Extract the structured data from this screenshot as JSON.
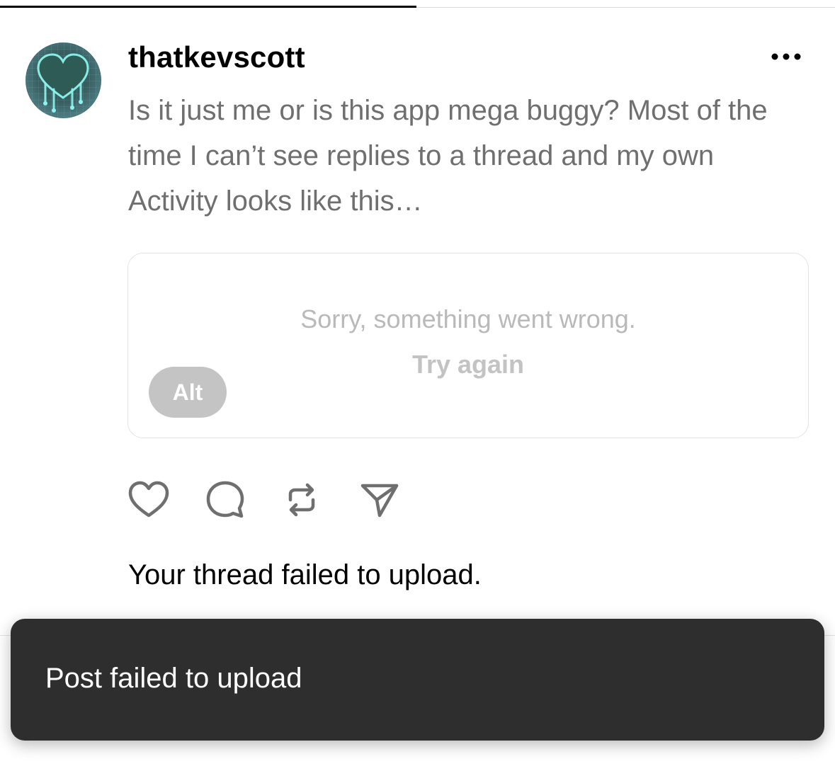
{
  "tabs": {
    "active_index": 0
  },
  "post": {
    "username": "thatkevscott",
    "text": "Is it just me or is this app mega buggy? Most of the time I can’t see replies to a thread and my own Activity looks like this…",
    "avatar_icon": "neon-heart-avatar-icon",
    "more_icon": "more-horizontal-icon",
    "media": {
      "error_message": "Sorry, something went wrong.",
      "retry_label": "Try again",
      "alt_label": "Alt"
    },
    "actions": [
      {
        "name": "like",
        "icon": "heart-icon"
      },
      {
        "name": "reply",
        "icon": "comment-icon"
      },
      {
        "name": "repost",
        "icon": "repost-icon"
      },
      {
        "name": "share",
        "icon": "send-icon"
      }
    ],
    "status_message": "Your thread failed to upload."
  },
  "toast": {
    "message": "Post failed to upload"
  },
  "colors": {
    "toast_bg": "#2e2e2e",
    "secondary_text": "#6f6f6f",
    "muted_text": "#b9b9b9",
    "alt_badge": "#c4c4c4",
    "icon": "#7a7a7a"
  }
}
